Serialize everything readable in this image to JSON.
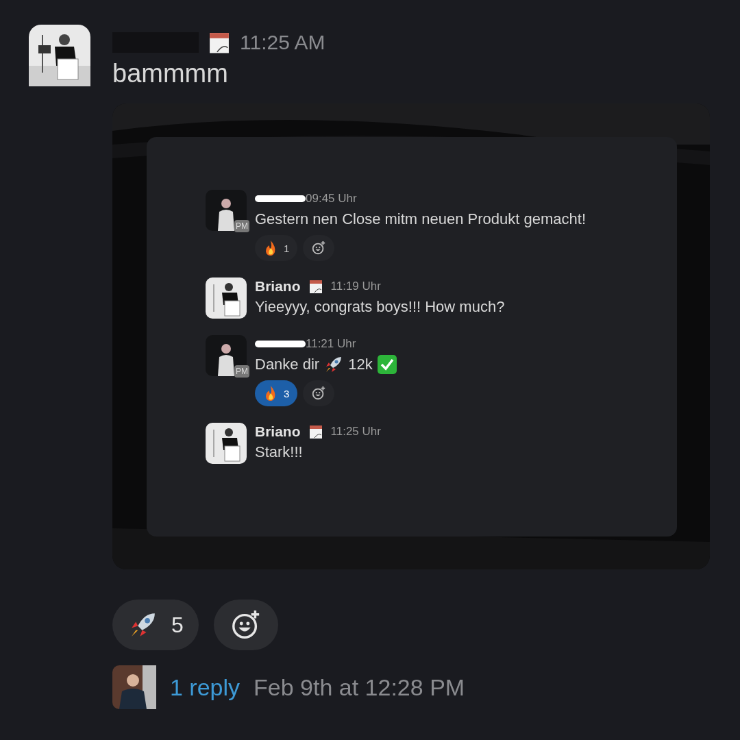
{
  "message": {
    "author_redacted": true,
    "status_icon": true,
    "time": "11:25 AM",
    "text": "bammmm"
  },
  "embed": {
    "messages": [
      {
        "badge": "PM",
        "name_redacted": true,
        "time": "09:45 Uhr",
        "parts": [
          {
            "kind": "text",
            "text": "Gestern nen Close mitm neuen Produkt gemacht!"
          }
        ],
        "reactions": [
          {
            "kind": "fire",
            "count": "1",
            "selected": false
          }
        ]
      },
      {
        "name_redacted": false,
        "name": "Briano",
        "status_icon": true,
        "time": "11:19 Uhr",
        "parts": [
          {
            "kind": "text",
            "text": "Yieeyyy, congrats boys!!! How much?"
          }
        ]
      },
      {
        "badge": "PM",
        "name_redacted": true,
        "time": "11:21 Uhr",
        "parts": [
          {
            "kind": "text",
            "text": "Danke dir"
          },
          {
            "kind": "rocket"
          },
          {
            "kind": "text",
            "text": "12k"
          },
          {
            "kind": "check"
          }
        ],
        "reactions": [
          {
            "kind": "fire",
            "count": "3",
            "selected": true
          }
        ]
      },
      {
        "name_redacted": false,
        "name": "Briano",
        "status_icon": true,
        "time": "11:25 Uhr",
        "parts": [
          {
            "kind": "text",
            "text": "Stark!!!"
          }
        ]
      }
    ]
  },
  "reactions": [
    {
      "kind": "rocket",
      "count": "5",
      "selected": false
    }
  ],
  "thread": {
    "replies": "1 reply",
    "last_reply": "Feb 9th at 12:28 PM"
  }
}
